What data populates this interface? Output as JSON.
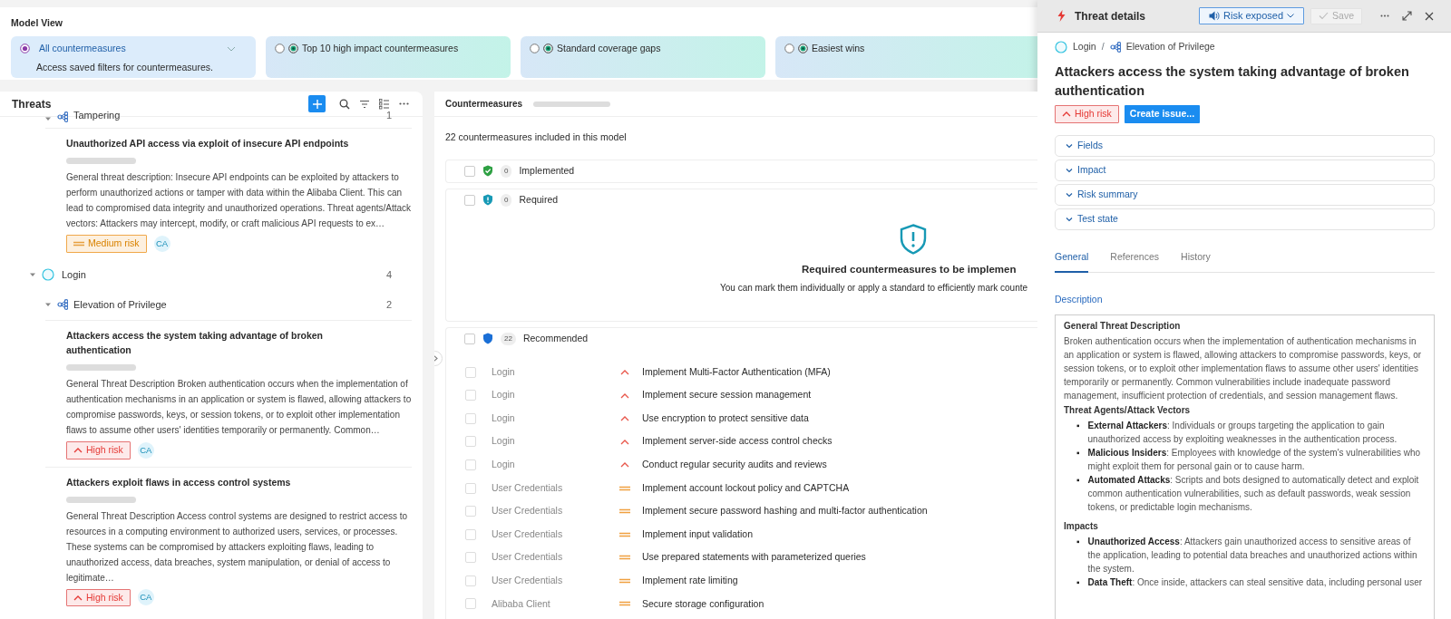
{
  "model_view": {
    "title": "Model View",
    "options": [
      {
        "label": "All countermeasures",
        "description": "Access saved filters for countermeasures.",
        "selected": true,
        "kind": "dropdown"
      },
      {
        "label": "Top 10 high impact countermeasures",
        "selected": false,
        "kind": "preset"
      },
      {
        "label": "Standard coverage gaps",
        "selected": false,
        "kind": "preset"
      },
      {
        "label": "Easiest wins",
        "selected": false,
        "kind": "preset"
      }
    ]
  },
  "threats": {
    "title": "Threats",
    "tree": [
      {
        "kind": "category",
        "label": "Tampering",
        "count": "1",
        "expanded": true,
        "children": [
          {
            "kind": "threat",
            "title": "Unauthorized API access via exploit of insecure API endpoints",
            "description": "General threat description:  Insecure API endpoints can be exploited by attackers to perform unauthorized actions or tamper with data within the Alibaba Client. This can lead to compromised data integrity and unauthorized operations.  Threat agents/Attack vectors:  Attackers may intercept, modify, or craft malicious API requests to ex…",
            "risk": {
              "kind": "medium",
              "label": "Medium risk"
            },
            "assignee": "CA"
          }
        ]
      },
      {
        "kind": "component",
        "label": "Login",
        "count": "4",
        "expanded": true,
        "children": [
          {
            "kind": "category",
            "label": "Elevation of Privilege",
            "count": "2",
            "expanded": true,
            "children": [
              {
                "kind": "threat",
                "title": "Attackers access the system taking advantage of broken authentication",
                "description": "General Threat Description Broken authentication occurs when the implementation of authentication mechanisms in an application or system is flawed, allowing attackers to compromise passwords, keys, or session tokens, or to exploit other implementation flaws to assume other users' identities temporarily or permanently. Common…",
                "risk": {
                  "kind": "high",
                  "label": "High risk"
                },
                "assignee": "CA"
              },
              {
                "kind": "threat",
                "title": "Attackers exploit flaws in access control systems",
                "description": "General Threat Description Access control systems are designed to restrict access to resources in a computing environment to authorized users, services, or processes. These systems can be compromised by attackers exploiting flaws, leading to unauthorized access, data breaches, system manipulation, or denial of access to legitimate…",
                "risk": {
                  "kind": "high",
                  "label": "High risk"
                },
                "assignee": "CA"
              }
            ]
          }
        ]
      }
    ]
  },
  "countermeasures": {
    "title": "Countermeasures",
    "summary": "22 countermeasures included in this model",
    "sections": [
      {
        "kind": "implemented",
        "label": "Implemented",
        "count": "0",
        "checked": false
      },
      {
        "kind": "required",
        "label": "Required",
        "count": "0",
        "checked": false,
        "empty_state": {
          "title": "Required countermeasures to be implemen",
          "text": "You can mark them individually or apply a standard to efficiently mark counte"
        }
      },
      {
        "kind": "recommended",
        "label": "Recommended",
        "count": "22",
        "checked": false,
        "rows": [
          {
            "component": "Login",
            "kind": "high",
            "name": "Implement Multi-Factor Authentication (MFA)",
            "checked": false
          },
          {
            "component": "Login",
            "kind": "high",
            "name": "Implement secure session management",
            "checked": false
          },
          {
            "component": "Login",
            "kind": "high",
            "name": "Use encryption to protect sensitive data",
            "checked": false
          },
          {
            "component": "Login",
            "kind": "high",
            "name": "Implement server-side access control checks",
            "checked": false
          },
          {
            "component": "Login",
            "kind": "high",
            "name": "Conduct regular security audits and reviews",
            "checked": false
          },
          {
            "component": "User Credentials",
            "kind": "medium",
            "name": "Implement account lockout policy and CAPTCHA",
            "checked": false
          },
          {
            "component": "User Credentials",
            "kind": "medium",
            "name": "Implement secure password hashing and multi-factor authentication",
            "checked": false
          },
          {
            "component": "User Credentials",
            "kind": "medium",
            "name": "Implement input validation",
            "checked": false
          },
          {
            "component": "User Credentials",
            "kind": "medium",
            "name": "Use prepared statements with parameterized queries",
            "checked": false
          },
          {
            "component": "User Credentials",
            "kind": "medium",
            "name": "Implement rate limiting",
            "checked": false
          },
          {
            "component": "Alibaba Client",
            "kind": "medium",
            "name": "Secure storage configuration",
            "checked": false
          }
        ]
      }
    ]
  },
  "threat_details": {
    "title": "Threat details",
    "status_button": "Risk exposed",
    "save_button": {
      "label": "Save",
      "disabled": true
    },
    "breadcrumb": [
      {
        "kind": "component",
        "label": "Login"
      },
      {
        "kind": "category",
        "label": "Elevation of Privilege"
      }
    ],
    "separator": "/",
    "heading": "Attackers access the system taking advantage of broken authentication",
    "risk": {
      "kind": "high",
      "label": "High risk"
    },
    "create_issue": "Create issue...",
    "sections": [
      {
        "label": "Fields",
        "expanded": false
      },
      {
        "label": "Impact",
        "expanded": false
      },
      {
        "label": "Risk summary",
        "expanded": false
      },
      {
        "label": "Test state",
        "expanded": false
      }
    ],
    "tabs": [
      {
        "label": "General",
        "selected": true
      },
      {
        "label": "References",
        "selected": false
      },
      {
        "label": "History",
        "selected": false
      }
    ],
    "description_label": "Description",
    "description": [
      {
        "kind": "heading",
        "text": "General Threat Description"
      },
      {
        "kind": "paragraph",
        "text": "Broken authentication occurs when the implementation of authentication mechanisms in an application or system is flawed, allowing attackers to compromise passwords, keys, or session tokens, or to exploit other implementation flaws to assume other users' identities temporarily or permanently. Common vulnerabilities include inadequate password management, insufficient protection of credentials, and session management flaws."
      },
      {
        "kind": "heading",
        "text": "Threat Agents/Attack Vectors"
      },
      {
        "kind": "list",
        "marker": "▪",
        "items": [
          "**External Attackers**: Individuals or groups targeting the application to gain unauthorized access by exploiting weaknesses in the authentication process.",
          "**Malicious Insiders**: Employees with knowledge of the system's vulnerabilities who might exploit them for personal gain or to cause harm.",
          "**Automated Attacks**: Scripts and bots designed to automatically detect and exploit common authentication vulnerabilities, such as default passwords, weak session tokens, or predictable login mechanisms."
        ]
      },
      {
        "kind": "heading",
        "text": "Impacts"
      },
      {
        "kind": "list",
        "marker": "▪",
        "items": [
          "**Unauthorized Access**: Attackers gain unauthorized access to sensitive areas of the application, leading to potential data breaches and unauthorized actions within the system.",
          "**Data Theft**: Once inside, attackers can steal sensitive data, including personal user"
        ]
      }
    ]
  }
}
